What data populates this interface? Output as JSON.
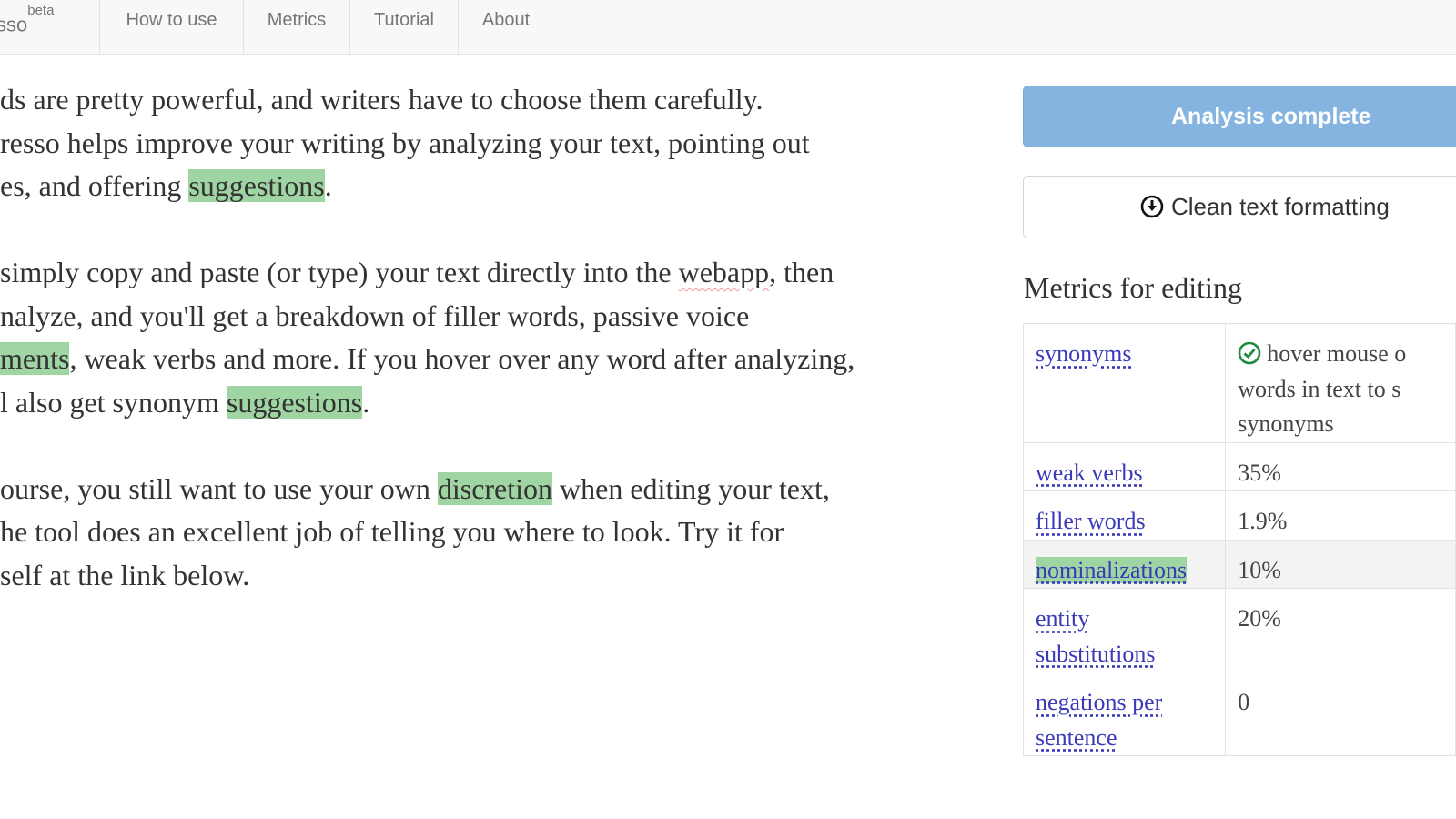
{
  "navbar": {
    "brand": "sso",
    "brand_sup": "beta",
    "links": [
      "How to use",
      "Metrics",
      "Tutorial",
      "About"
    ]
  },
  "editor": {
    "paragraphs": [
      [
        [
          {
            "t": "ds are pretty powerful, and writers have to choose them carefully."
          }
        ],
        [
          {
            "t": "resso helps improve your writing by analyzing your text, pointing out"
          }
        ],
        [
          {
            "t": "es, and offering "
          },
          {
            "t": "suggestions",
            "hl": true
          },
          {
            "t": "."
          }
        ]
      ],
      [
        [
          {
            "t": "simply copy and paste (or type) your text directly into the "
          },
          {
            "t": "webapp",
            "spell": true
          },
          {
            "t": ", then"
          }
        ],
        [
          {
            "t": "nalyze, and you'll get a breakdown of filler words, passive voice"
          }
        ],
        [
          {
            "t": "ments",
            "hl": true
          },
          {
            "t": ", weak verbs and more. If you hover over any word after analyzing,"
          }
        ],
        [
          {
            "t": "l also get synonym "
          },
          {
            "t": "suggestions",
            "hl": true
          },
          {
            "t": "."
          }
        ]
      ],
      [
        [
          {
            "t": "ourse, you still want to use your own "
          },
          {
            "t": "discretion",
            "hl": true
          },
          {
            "t": " when editing your text,"
          }
        ],
        [
          {
            "t": "he tool does an excellent job of telling you where to look. Try it for"
          }
        ],
        [
          {
            "t": "self at the link below."
          }
        ]
      ]
    ]
  },
  "sidebar": {
    "analysis_label": "Analysis complete",
    "clean_label": "Clean text formatting",
    "clean_icon": "download-circle-icon",
    "metrics_heading": "Metrics for editing",
    "metrics": [
      {
        "name": "synonyms",
        "value": "hover mouse o\nwords in text to s\nsynonyms",
        "check_icon": true
      },
      {
        "name": "weak verbs",
        "value": "35%"
      },
      {
        "name": "filler words",
        "value": "1.9%"
      },
      {
        "name": "nominalizations",
        "value": "10%",
        "active": true
      },
      {
        "name": "entity substitutions",
        "value": "20%"
      },
      {
        "name": "negations per sentence",
        "value": "0"
      }
    ],
    "accent_green": "#9fd5a2",
    "accent_blue": "#86b4e0"
  }
}
